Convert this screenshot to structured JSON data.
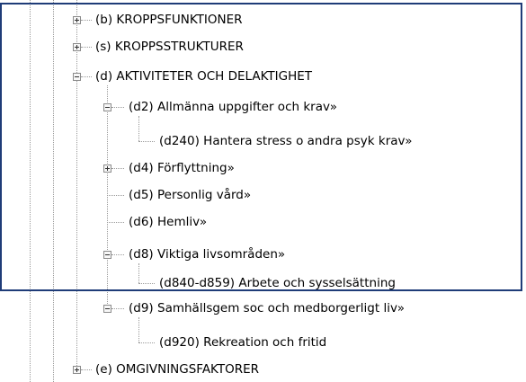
{
  "tree": {
    "items": [
      {
        "code": "(b)",
        "label": "KROPPSFUNKTIONER",
        "state": "collapsed"
      },
      {
        "code": "(s)",
        "label": "KROPPSSTRUKTURER",
        "state": "collapsed"
      },
      {
        "code": "(d)",
        "label": "AKTIVITETER OCH DELAKTIGHET",
        "state": "expanded"
      },
      {
        "code": "(d2)",
        "label": "Allmänna uppgifter och krav»",
        "state": "expanded"
      },
      {
        "code": "(d240)",
        "label": "Hantera stress o andra psyk krav»",
        "state": "leaf"
      },
      {
        "code": "(d4)",
        "label": "Förflyttning»",
        "state": "collapsed"
      },
      {
        "code": "(d5)",
        "label": "Personlig vård»",
        "state": "leaf"
      },
      {
        "code": "(d6)",
        "label": "Hemliv»",
        "state": "leaf"
      },
      {
        "code": "(d8)",
        "label": "Viktiga livsområden»",
        "state": "expanded"
      },
      {
        "code": "(d840-d859)",
        "label": "Arbete och sysselsättning",
        "state": "leaf"
      },
      {
        "code": "(d9)",
        "label": "Samhällsgem soc och medborgerligt liv»",
        "state": "expanded"
      },
      {
        "code": "(d920)",
        "label": "Rekreation och fritid",
        "state": "leaf"
      },
      {
        "code": "(e)",
        "label": "OMGIVNINGSFAKTORER",
        "state": "collapsed"
      }
    ]
  },
  "colors": {
    "selection_border": "#1f3c78",
    "tree_lines": "#9a9a9a"
  }
}
